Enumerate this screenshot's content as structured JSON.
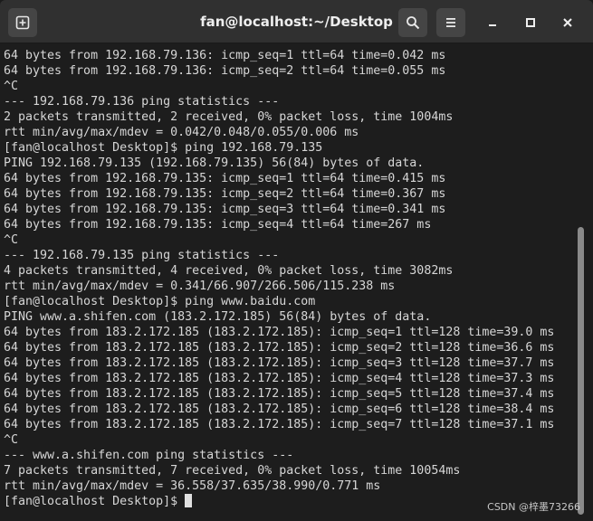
{
  "window": {
    "title": "fan@localhost:~/Desktop"
  },
  "icons": {
    "new_tab": "new-tab-icon",
    "search": "search-icon",
    "menu": "hamburger-menu-icon",
    "minimize": "minimize-icon",
    "maximize": "maximize-icon",
    "close": "close-icon"
  },
  "terminal": {
    "lines": [
      "64 bytes from 192.168.79.136: icmp_seq=1 ttl=64 time=0.042 ms",
      "64 bytes from 192.168.79.136: icmp_seq=2 ttl=64 time=0.055 ms",
      "^C",
      "--- 192.168.79.136 ping statistics ---",
      "2 packets transmitted, 2 received, 0% packet loss, time 1004ms",
      "rtt min/avg/max/mdev = 0.042/0.048/0.055/0.006 ms",
      "[fan@localhost Desktop]$ ping 192.168.79.135",
      "PING 192.168.79.135 (192.168.79.135) 56(84) bytes of data.",
      "64 bytes from 192.168.79.135: icmp_seq=1 ttl=64 time=0.415 ms",
      "64 bytes from 192.168.79.135: icmp_seq=2 ttl=64 time=0.367 ms",
      "64 bytes from 192.168.79.135: icmp_seq=3 ttl=64 time=0.341 ms",
      "64 bytes from 192.168.79.135: icmp_seq=4 ttl=64 time=267 ms",
      "^C",
      "--- 192.168.79.135 ping statistics ---",
      "4 packets transmitted, 4 received, 0% packet loss, time 3082ms",
      "rtt min/avg/max/mdev = 0.341/66.907/266.506/115.238 ms",
      "[fan@localhost Desktop]$ ping www.baidu.com",
      "PING www.a.shifen.com (183.2.172.185) 56(84) bytes of data.",
      "64 bytes from 183.2.172.185 (183.2.172.185): icmp_seq=1 ttl=128 time=39.0 ms",
      "64 bytes from 183.2.172.185 (183.2.172.185): icmp_seq=2 ttl=128 time=36.6 ms",
      "64 bytes from 183.2.172.185 (183.2.172.185): icmp_seq=3 ttl=128 time=37.7 ms",
      "64 bytes from 183.2.172.185 (183.2.172.185): icmp_seq=4 ttl=128 time=37.3 ms",
      "64 bytes from 183.2.172.185 (183.2.172.185): icmp_seq=5 ttl=128 time=37.4 ms",
      "64 bytes from 183.2.172.185 (183.2.172.185): icmp_seq=6 ttl=128 time=38.4 ms",
      "64 bytes from 183.2.172.185 (183.2.172.185): icmp_seq=7 ttl=128 time=37.1 ms",
      "^C",
      "--- www.a.shifen.com ping statistics ---",
      "7 packets transmitted, 7 received, 0% packet loss, time 10054ms",
      "rtt min/avg/max/mdev = 36.558/37.635/38.990/0.771 ms"
    ],
    "prompt": "[fan@localhost Desktop]$ "
  },
  "watermark": "CSDN @梓墨73266",
  "colors": {
    "titlebar_bg": "#303030",
    "terminal_bg": "#1d1d1d",
    "terminal_fg": "#d6d6d6",
    "button_bg": "#454545"
  }
}
